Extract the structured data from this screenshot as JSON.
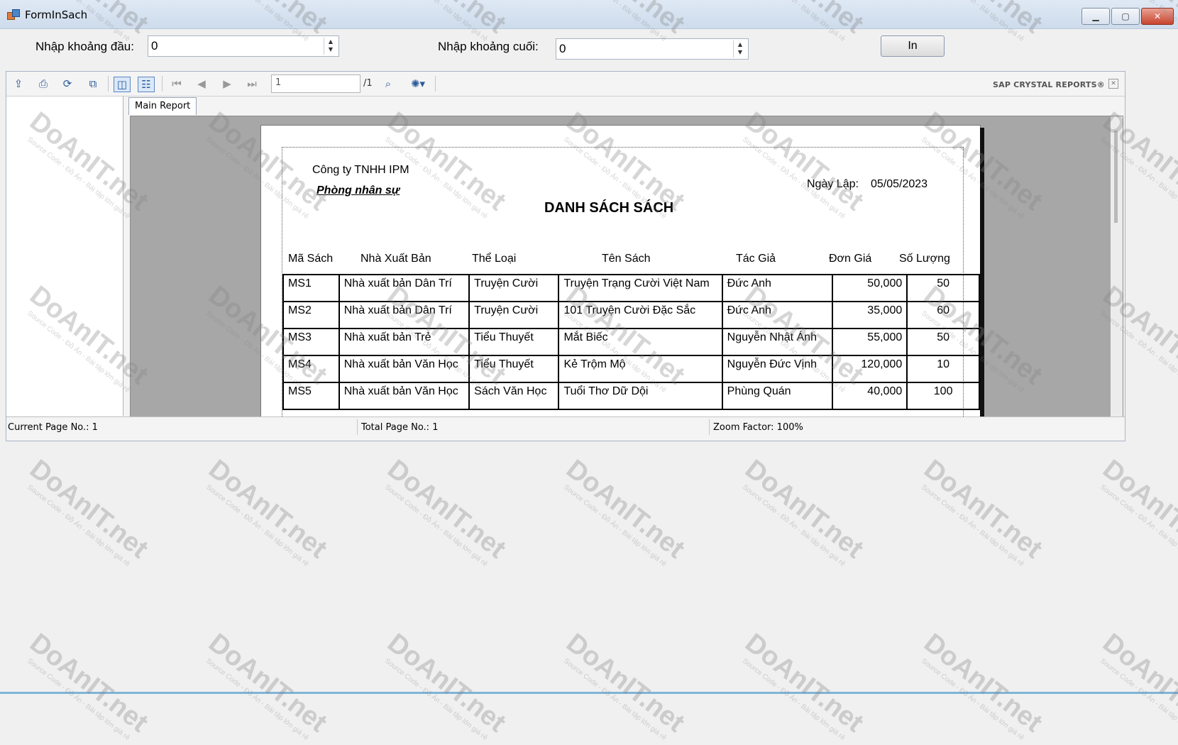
{
  "window": {
    "title": "FormInSach",
    "minimize_glyph": "▁",
    "maximize_glyph": "▢",
    "close_glyph": "✕"
  },
  "form": {
    "start_label": "Nhập khoảng đầu:",
    "start_value": "0",
    "end_label": "Nhập khoảng cuối:",
    "end_value": "0",
    "print_button": "In"
  },
  "viewer": {
    "current_page_input": "1",
    "total_pages": "/1",
    "brand": "SAP CRYSTAL REPORTS®",
    "tab_label": "Main Report",
    "status": {
      "current_page": "Current Page No.: 1",
      "total_page": "Total Page No.: 1",
      "zoom": "Zoom Factor: 100%"
    },
    "toolbar_icons": [
      "export-icon",
      "print-icon",
      "refresh-icon",
      "copy-icon",
      "group-tree-toggle-icon",
      "parameter-panel-icon",
      "first-page-icon",
      "previous-page-icon",
      "next-page-icon",
      "last-page-icon",
      "search-icon",
      "zoom-icon"
    ]
  },
  "report": {
    "company": "Công ty TNHH IPM",
    "department": "Phòng nhân sự",
    "date_label": "Ngày Lập:",
    "date_value": "05/05/2023",
    "title": "DANH SÁCH SÁCH",
    "columns": [
      "Mã Sách",
      "Nhà Xuất Bản",
      "Thể Loại",
      "Tên Sách",
      "Tác Giả",
      "Đơn Giá",
      "Số Lượng"
    ],
    "rows": [
      [
        "MS1",
        "Nhà xuất bản Dân Trí",
        "Truyện Cười",
        "Truyện Trạng Cười Việt Nam",
        "Đức Anh",
        "50,000",
        "50"
      ],
      [
        "MS2",
        "Nhà xuất bản Dân Trí",
        "Truyện Cười",
        "101 Truyện Cười Đặc Sắc",
        "Đức Anh",
        "35,000",
        "60"
      ],
      [
        "MS3",
        "Nhà xuất bản Trẻ",
        "Tiểu Thuyết",
        "Mắt Biếc",
        "Nguyễn Nhật Ánh",
        "55,000",
        "50"
      ],
      [
        "MS4",
        "Nhà xuất bản Văn Học",
        "Tiểu Thuyết",
        "Kẻ Trộm Mộ",
        "Nguyễn Đức Vịnh",
        "120,000",
        "10"
      ],
      [
        "MS5",
        "Nhà xuất bản Văn Học",
        "Sách Văn Học",
        "Tuổi Thơ Dữ Dội",
        "Phùng Quán",
        "40,000",
        "100"
      ]
    ]
  },
  "watermark": {
    "brand": "DoAnIT.net",
    "tagline": "Source Code - Đồ Án - Bài tập lớn giá rẻ"
  }
}
